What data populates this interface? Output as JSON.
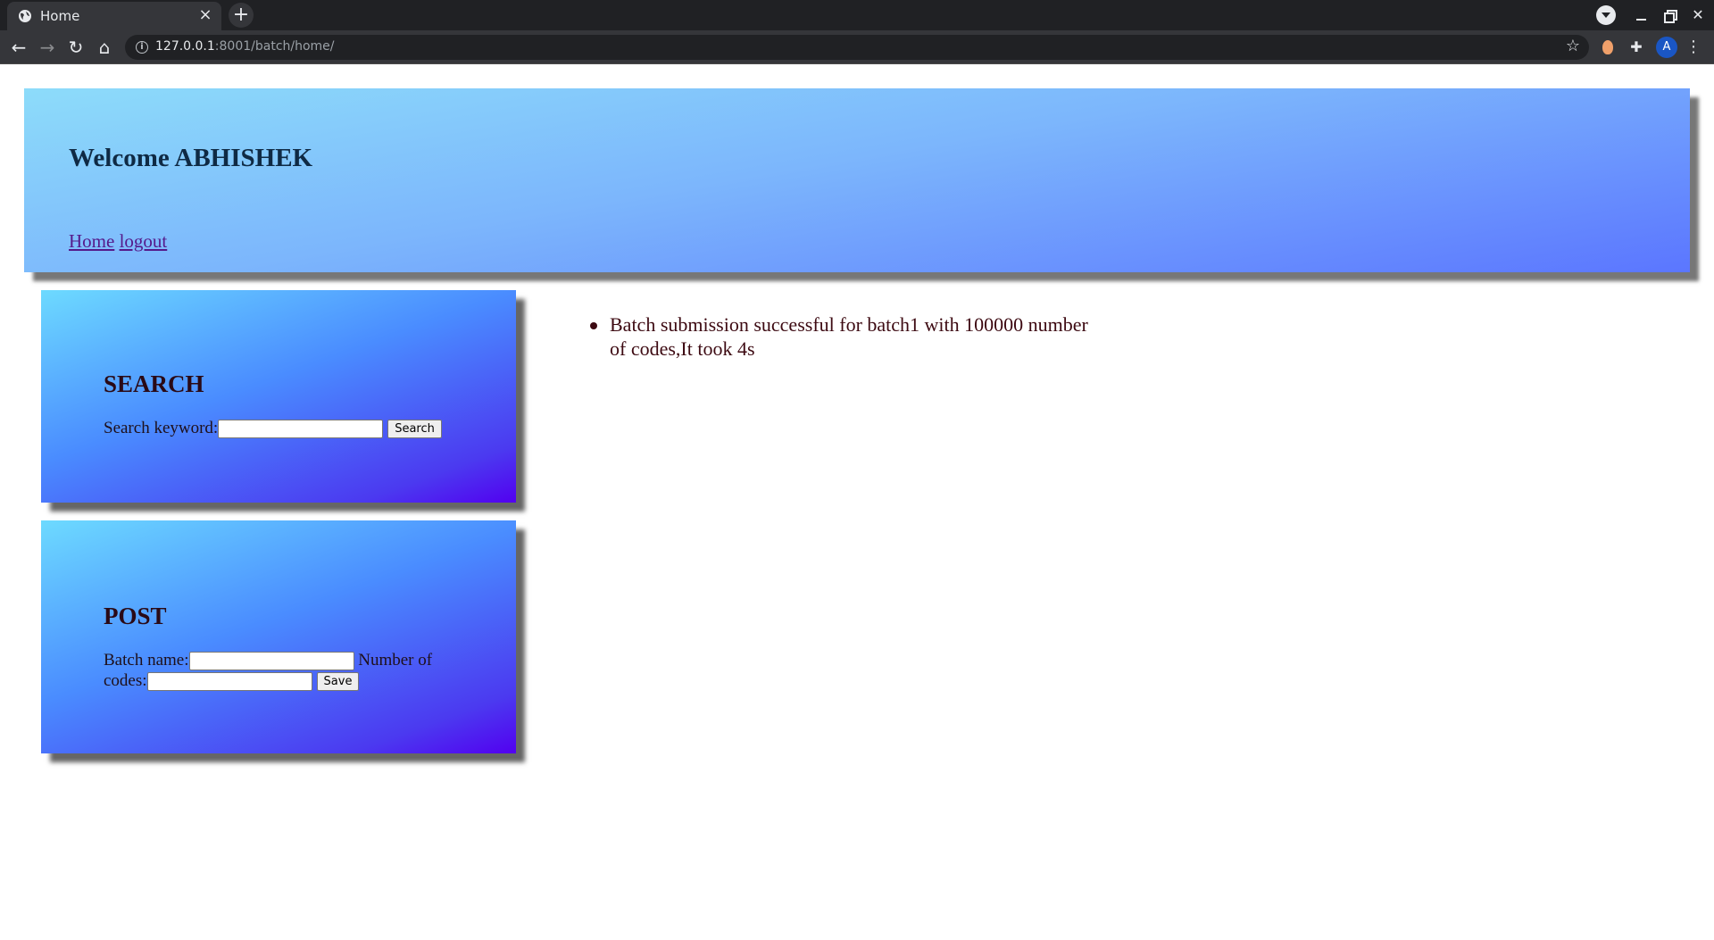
{
  "browser": {
    "tab_title": "Home",
    "tab_close": "×",
    "new_tab": "+",
    "url_host": "127.0.0.1",
    "url_path": ":8001/batch/home/",
    "avatar_letter": "A",
    "icons": [
      "globe-icon",
      "close-icon",
      "plus-icon",
      "chevron-down-icon",
      "minimize-icon",
      "restore-icon",
      "close-window-icon",
      "back-icon",
      "forward-icon",
      "reload-icon",
      "home-icon",
      "info-icon",
      "star-icon",
      "fox-extension-icon",
      "puzzle-icon",
      "menu-dots-icon"
    ]
  },
  "header": {
    "title": "Welcome ABHISHEK",
    "nav": {
      "home": "Home",
      "logout": "logout"
    }
  },
  "search": {
    "heading": "SEARCH",
    "label": "Search keyword:",
    "input_value": "",
    "button": "Search"
  },
  "post": {
    "heading": "POST",
    "batch_label": "Batch name:",
    "batch_value": "",
    "codes_label": "Number of codes:",
    "codes_value": "",
    "button": "Save"
  },
  "messages": [
    "Batch submission successful for batch1 with 100000 number of codes,It took 4s"
  ],
  "colors": {
    "header_gradient": [
      "#8ddcfa",
      "#5b76ff"
    ],
    "card_gradient": [
      "#6ddaff",
      "#5200f0"
    ],
    "link": "#551a8b",
    "message_text": "#3d0a12"
  }
}
